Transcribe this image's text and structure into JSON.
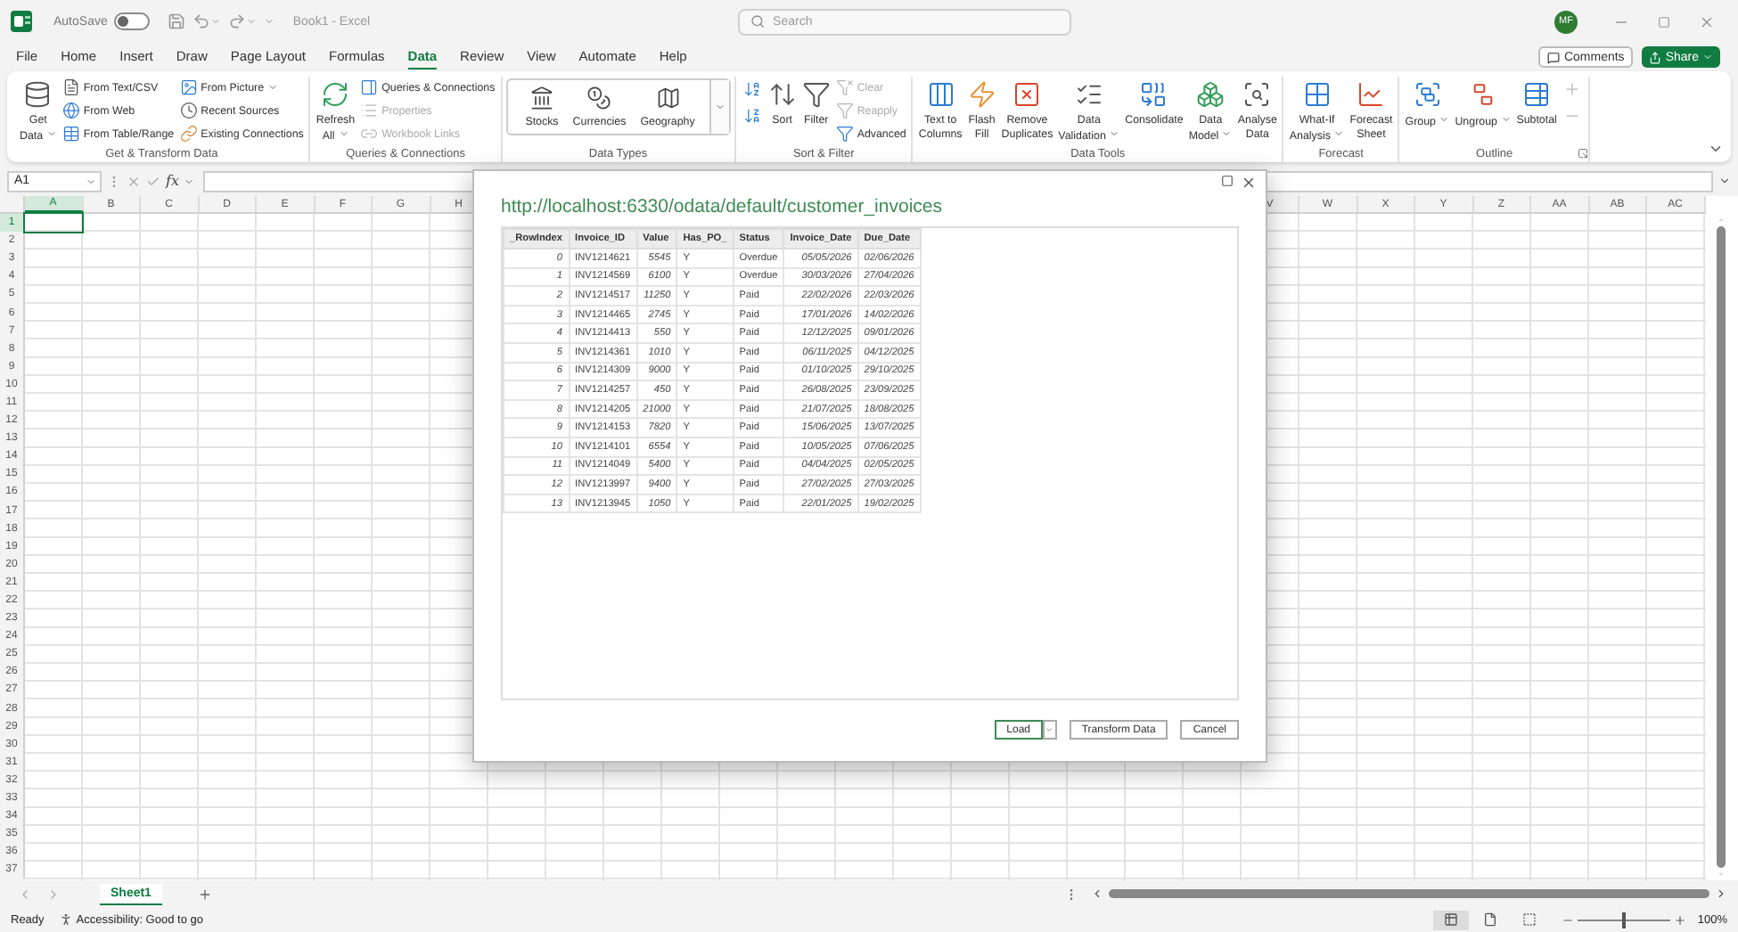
{
  "title_bar": {
    "autosave_label": "AutoSave",
    "autosave_on": false,
    "document_title": "Book1 - Excel",
    "search_placeholder": "Search",
    "avatar": "MF"
  },
  "menu_tabs": [
    {
      "label": "File",
      "selected": false
    },
    {
      "label": "Home",
      "selected": false
    },
    {
      "label": "Insert",
      "selected": false
    },
    {
      "label": "Draw",
      "selected": false
    },
    {
      "label": "Page Layout",
      "selected": false
    },
    {
      "label": "Formulas",
      "selected": false
    },
    {
      "label": "Data",
      "selected": true
    },
    {
      "label": "Review",
      "selected": false
    },
    {
      "label": "View",
      "selected": false
    },
    {
      "label": "Automate",
      "selected": false
    },
    {
      "label": "Help",
      "selected": false
    }
  ],
  "actions": {
    "comments": "Comments",
    "share": "Share"
  },
  "ribbon": {
    "groups": [
      {
        "title": "Get & Transform Data",
        "items": [
          {
            "kind": "large",
            "lines": [
              "Get",
              "Data"
            ],
            "dropdown": true,
            "disabled": false
          },
          {
            "kind": "small",
            "lines": [
              "From Text/CSV"
            ],
            "dropdown": false,
            "disabled": false
          },
          {
            "kind": "small",
            "lines": [
              "From Web"
            ],
            "dropdown": false,
            "disabled": false
          },
          {
            "kind": "small",
            "lines": [
              "From Table/Range"
            ],
            "dropdown": false,
            "disabled": false
          },
          {
            "kind": "small",
            "lines": [
              "From Picture"
            ],
            "dropdown": true,
            "disabled": false
          },
          {
            "kind": "small",
            "lines": [
              "Recent Sources"
            ],
            "dropdown": false,
            "disabled": false
          },
          {
            "kind": "small",
            "lines": [
              "Existing Connections"
            ],
            "dropdown": false,
            "disabled": false
          }
        ]
      },
      {
        "title": "Queries & Connections",
        "items": [
          {
            "kind": "large",
            "lines": [
              "Refresh",
              "All"
            ],
            "dropdown": true,
            "disabled": false
          },
          {
            "kind": "small",
            "lines": [
              "Queries & Connections"
            ],
            "dropdown": false,
            "disabled": false
          },
          {
            "kind": "small",
            "lines": [
              "Properties"
            ],
            "dropdown": false,
            "disabled": true
          },
          {
            "kind": "small",
            "lines": [
              "Workbook Links"
            ],
            "dropdown": false,
            "disabled": true
          }
        ]
      },
      {
        "title": "Data Types",
        "items": [
          {
            "kind": "gallery",
            "lines": [
              "Stocks"
            ],
            "disabled": false
          },
          {
            "kind": "gallery",
            "lines": [
              "Currencies"
            ],
            "disabled": false
          },
          {
            "kind": "gallery",
            "lines": [
              "Geography"
            ],
            "disabled": false
          }
        ]
      },
      {
        "title": "Sort & Filter",
        "items": [
          {
            "kind": "icon",
            "dropdown": false,
            "disabled": false
          },
          {
            "kind": "icon",
            "dropdown": false,
            "disabled": false
          },
          {
            "kind": "large",
            "lines": [
              "Sort"
            ],
            "dropdown": false,
            "disabled": false
          },
          {
            "kind": "large",
            "lines": [
              "Filter"
            ],
            "dropdown": false,
            "disabled": false
          },
          {
            "kind": "small",
            "lines": [
              "Clear"
            ],
            "dropdown": false,
            "disabled": true
          },
          {
            "kind": "small",
            "lines": [
              "Reapply"
            ],
            "dropdown": false,
            "disabled": true
          },
          {
            "kind": "small",
            "lines": [
              "Advanced"
            ],
            "dropdown": false,
            "disabled": false
          }
        ]
      },
      {
        "title": "Data Tools",
        "items": [
          {
            "kind": "large",
            "lines": [
              "Text to",
              "Columns"
            ],
            "dropdown": false,
            "disabled": false
          },
          {
            "kind": "large",
            "lines": [
              "Flash",
              "Fill"
            ],
            "dropdown": false,
            "disabled": false
          },
          {
            "kind": "large",
            "lines": [
              "Remove",
              "Duplicates"
            ],
            "dropdown": false,
            "disabled": false
          },
          {
            "kind": "large",
            "lines": [
              "Data",
              "Validation"
            ],
            "dropdown": true,
            "disabled": false
          },
          {
            "kind": "large",
            "lines": [
              "Consolidate"
            ],
            "dropdown": false,
            "disabled": false
          },
          {
            "kind": "large",
            "lines": [
              "Data",
              "Model"
            ],
            "dropdown": true,
            "disabled": false
          },
          {
            "kind": "large",
            "lines": [
              "Analyse",
              "Data"
            ],
            "dropdown": false,
            "disabled": false
          }
        ]
      },
      {
        "title": "Forecast",
        "items": [
          {
            "kind": "large",
            "lines": [
              "What-If",
              "Analysis"
            ],
            "dropdown": true,
            "disabled": false
          },
          {
            "kind": "large",
            "lines": [
              "Forecast",
              "Sheet"
            ],
            "dropdown": false,
            "disabled": false
          }
        ]
      },
      {
        "title": "Outline",
        "items": [
          {
            "kind": "large",
            "lines": [
              "Group"
            ],
            "dropdown": true,
            "disabled": false
          },
          {
            "kind": "large",
            "lines": [
              "Ungroup"
            ],
            "dropdown": true,
            "disabled": false
          },
          {
            "kind": "large",
            "lines": [
              "Subtotal"
            ],
            "dropdown": false,
            "disabled": false
          },
          {
            "kind": "icon",
            "dropdown": false,
            "disabled": true
          },
          {
            "kind": "icon",
            "dropdown": false,
            "disabled": true
          }
        ]
      }
    ]
  },
  "formula_bar": {
    "name_box": "A1",
    "function_label": "fx"
  },
  "sheet": {
    "columns_left": [
      {
        "label": "A",
        "selected": true
      },
      {
        "label": "B",
        "selected": false
      },
      {
        "label": "C",
        "selected": false
      },
      {
        "label": "D",
        "selected": false
      },
      {
        "label": "E",
        "selected": false
      },
      {
        "label": "F",
        "selected": false
      },
      {
        "label": "G",
        "selected": false
      },
      {
        "label": "H",
        "selected": false
      }
    ],
    "columns_right": [
      {
        "label": "V",
        "selected": false
      },
      {
        "label": "W",
        "selected": false
      },
      {
        "label": "X",
        "selected": false
      },
      {
        "label": "Y",
        "selected": false
      },
      {
        "label": "Z",
        "selected": false
      },
      {
        "label": "AA",
        "selected": false
      },
      {
        "label": "AB",
        "selected": false
      },
      {
        "label": "AC",
        "selected": false
      }
    ],
    "rows": [
      {
        "label": "1",
        "selected": true
      },
      {
        "label": "2",
        "selected": false
      },
      {
        "label": "3",
        "selected": false
      },
      {
        "label": "4",
        "selected": false
      },
      {
        "label": "5",
        "selected": false
      },
      {
        "label": "6",
        "selected": false
      },
      {
        "label": "7",
        "selected": false
      },
      {
        "label": "8",
        "selected": false
      },
      {
        "label": "9",
        "selected": false
      },
      {
        "label": "10",
        "selected": false
      },
      {
        "label": "11",
        "selected": false
      },
      {
        "label": "12",
        "selected": false
      },
      {
        "label": "13",
        "selected": false
      },
      {
        "label": "14",
        "selected": false
      },
      {
        "label": "15",
        "selected": false
      },
      {
        "label": "16",
        "selected": false
      },
      {
        "label": "17",
        "selected": false
      },
      {
        "label": "18",
        "selected": false
      },
      {
        "label": "19",
        "selected": false
      },
      {
        "label": "20",
        "selected": false
      },
      {
        "label": "21",
        "selected": false
      },
      {
        "label": "22",
        "selected": false
      },
      {
        "label": "23",
        "selected": false
      },
      {
        "label": "24",
        "selected": false
      },
      {
        "label": "25",
        "selected": false
      },
      {
        "label": "26",
        "selected": false
      },
      {
        "label": "27",
        "selected": false
      },
      {
        "label": "28",
        "selected": false
      },
      {
        "label": "29",
        "selected": false
      },
      {
        "label": "30",
        "selected": false
      },
      {
        "label": "31",
        "selected": false
      },
      {
        "label": "32",
        "selected": false
      },
      {
        "label": "33",
        "selected": false
      },
      {
        "label": "34",
        "selected": false
      },
      {
        "label": "35",
        "selected": false
      },
      {
        "label": "36",
        "selected": false
      },
      {
        "label": "37",
        "selected": false
      }
    ]
  },
  "dialog": {
    "url": "http://localhost:6330/odata/default/customer_invoices",
    "columns": [
      {
        "label": "_RowIndex",
        "kind": "number"
      },
      {
        "label": "Invoice_ID",
        "kind": "text"
      },
      {
        "label": "Value",
        "kind": "number"
      },
      {
        "label": "Has_PO_",
        "kind": "text"
      },
      {
        "label": "Status",
        "kind": "text"
      },
      {
        "label": "Invoice_Date",
        "kind": "number"
      },
      {
        "label": "Due_Date",
        "kind": "number"
      }
    ],
    "rows": [
      [
        "0",
        "INV1214621",
        "5545",
        "Y",
        "Overdue",
        "05/05/2026",
        "02/06/2026"
      ],
      [
        "1",
        "INV1214569",
        "6100",
        "Y",
        "Overdue",
        "30/03/2026",
        "27/04/2026"
      ],
      [
        "2",
        "INV1214517",
        "11250",
        "Y",
        "Paid",
        "22/02/2026",
        "22/03/2026"
      ],
      [
        "3",
        "INV1214465",
        "2745",
        "Y",
        "Paid",
        "17/01/2026",
        "14/02/2026"
      ],
      [
        "4",
        "INV1214413",
        "550",
        "Y",
        "Paid",
        "12/12/2025",
        "09/01/2026"
      ],
      [
        "5",
        "INV1214361",
        "1010",
        "Y",
        "Paid",
        "06/11/2025",
        "04/12/2025"
      ],
      [
        "6",
        "INV1214309",
        "9000",
        "Y",
        "Paid",
        "01/10/2025",
        "29/10/2025"
      ],
      [
        "7",
        "INV1214257",
        "450",
        "Y",
        "Paid",
        "26/08/2025",
        "23/09/2025"
      ],
      [
        "8",
        "INV1214205",
        "21000",
        "Y",
        "Paid",
        "21/07/2025",
        "18/08/2025"
      ],
      [
        "9",
        "INV1214153",
        "7820",
        "Y",
        "Paid",
        "15/06/2025",
        "13/07/2025"
      ],
      [
        "10",
        "INV1214101",
        "6554",
        "Y",
        "Paid",
        "10/05/2025",
        "07/06/2025"
      ],
      [
        "11",
        "INV1214049",
        "5400",
        "Y",
        "Paid",
        "04/04/2025",
        "02/05/2025"
      ],
      [
        "12",
        "INV1213997",
        "9400",
        "Y",
        "Paid",
        "27/02/2025",
        "27/03/2025"
      ],
      [
        "13",
        "INV1213945",
        "1050",
        "Y",
        "Paid",
        "22/01/2025",
        "19/02/2025"
      ]
    ],
    "buttons": {
      "load": "Load",
      "transform": "Transform Data",
      "cancel": "Cancel"
    }
  },
  "sheet_tabs": [
    {
      "label": "Sheet1",
      "selected": true
    }
  ],
  "status_bar": {
    "ready": "Ready",
    "accessibility": "Accessibility: Good to go",
    "zoom": {
      "label": "100%",
      "level": 0.5
    },
    "views": [
      {
        "selected": true
      },
      {
        "selected": false
      },
      {
        "selected": false
      }
    ]
  }
}
